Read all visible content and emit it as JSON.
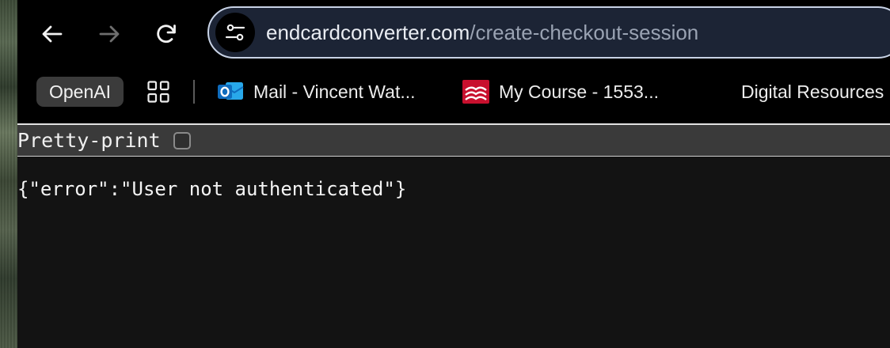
{
  "browser": {
    "omnibox": {
      "url_host": "endcardconverter.com",
      "url_path": "/create-checkout-session",
      "site_info_icon": "tune-icon"
    },
    "nav": {
      "back_icon": "arrow-left-icon",
      "forward_icon": "arrow-right-icon",
      "reload_icon": "reload-icon",
      "forward_enabled": false
    },
    "bookmarks": [
      {
        "label": "OpenAI",
        "icon": ""
      },
      {
        "label": "",
        "icon": "apps-grid-icon"
      },
      {
        "label": "Mail - Vincent Wat...",
        "icon": "outlook-icon"
      },
      {
        "label": "My Course - 1553...",
        "icon": "course-book-icon"
      },
      {
        "label": "Digital Resources",
        "icon": ""
      }
    ]
  },
  "page": {
    "pretty_print_label": "Pretty-print",
    "pretty_print_checked": false,
    "body_text": "{\"error\":\"User not authenticated\"}"
  },
  "colors": {
    "omnibox_border": "#c8d3e6",
    "omnibox_bg": "#1c2435",
    "outlook_blue": "#0f6cbd",
    "course_red": "#c8102e"
  }
}
